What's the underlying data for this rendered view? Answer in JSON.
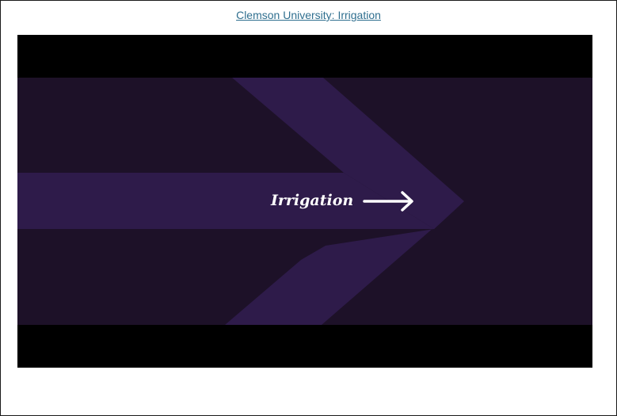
{
  "link": {
    "text": "Clemson University: Irrigation"
  },
  "video": {
    "title_text": "Irrigation"
  },
  "colors": {
    "link": "#2f6f8f",
    "letterbox": "#000000",
    "background_purple": "#1d1128",
    "arrow_purple": "#2e1b4a",
    "title_text": "#ffffff"
  }
}
